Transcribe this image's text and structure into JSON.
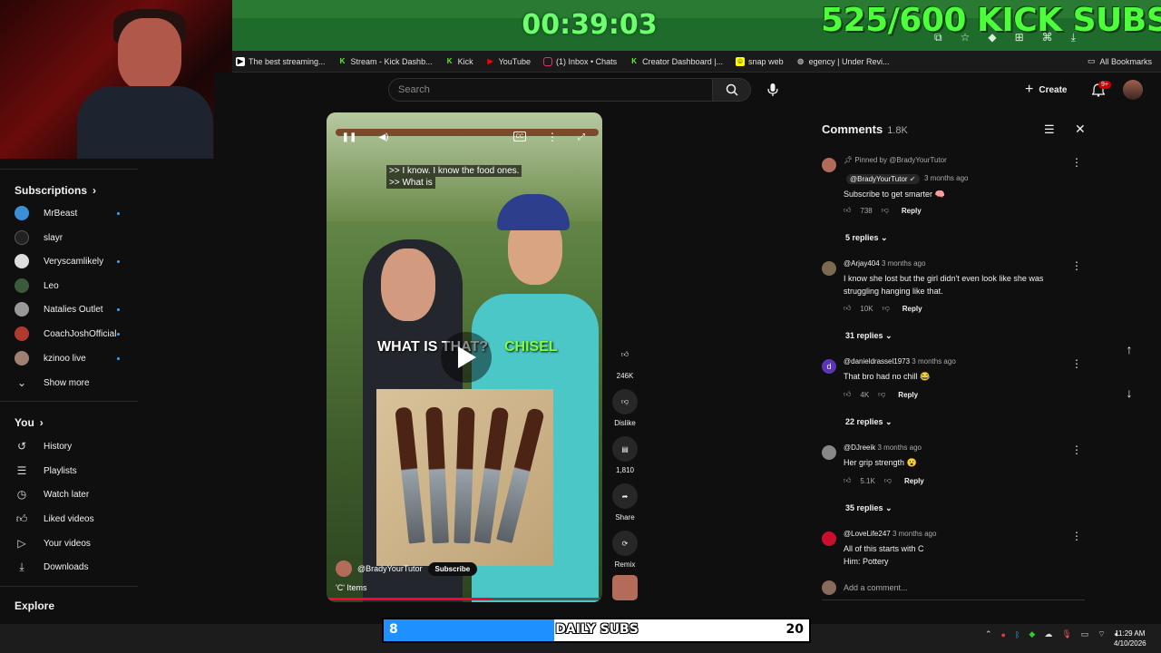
{
  "stream_overlay": {
    "timer": "00:39:03",
    "sub_goal": "525/600 KICK SUBS",
    "daily_subs": {
      "label": "DAILY SUBS",
      "current": "8",
      "target": "20",
      "progress": 0.4
    }
  },
  "bookmarks": {
    "items": [
      {
        "label": "The best streaming...",
        "icon": "clapper-icon",
        "color": "#ffffff"
      },
      {
        "label": "Stream - Kick Dashb...",
        "icon": "kick-icon",
        "color": "#53fc18"
      },
      {
        "label": "Kick",
        "icon": "kick-icon",
        "color": "#53fc18"
      },
      {
        "label": "YouTube",
        "icon": "youtube-icon",
        "color": "#ff0000"
      },
      {
        "label": "(1) Inbox • Chats",
        "icon": "instagram-icon",
        "color": "#e1306c"
      },
      {
        "label": "Creator Dashboard |...",
        "icon": "kick-icon",
        "color": "#53fc18"
      },
      {
        "label": "snap web",
        "icon": "snapchat-icon",
        "color": "#fffc00"
      },
      {
        "label": "egency | Under Revi...",
        "icon": "globe-icon",
        "color": "#888888"
      }
    ],
    "all_bookmarks": "All Bookmarks"
  },
  "header": {
    "search_placeholder": "Search",
    "create_label": "Create",
    "notification_badge": "9+"
  },
  "sidebar": {
    "subscriptions_title": "Subscriptions",
    "subscriptions": [
      {
        "label": "MrBeast",
        "new": true,
        "color": "#3a8fd6"
      },
      {
        "label": "slayr",
        "new": false,
        "color": "#222222"
      },
      {
        "label": "Veryscamlikely",
        "new": true,
        "color": "#dddddd"
      },
      {
        "label": "Leo",
        "new": false,
        "color": "#3a5a3a"
      },
      {
        "label": "Natalies Outlet",
        "new": true,
        "color": "#999999"
      },
      {
        "label": "CoachJoshOfficial",
        "new": true,
        "color": "#b03a2e"
      },
      {
        "label": "kzinoo live",
        "new": true,
        "color": "#a08070"
      }
    ],
    "show_more": "Show more",
    "you_title": "You",
    "you_items": [
      {
        "label": "History",
        "icon": "history-icon"
      },
      {
        "label": "Playlists",
        "icon": "playlist-icon"
      },
      {
        "label": "Watch later",
        "icon": "clock-icon"
      },
      {
        "label": "Liked videos",
        "icon": "thumbs-up-icon"
      },
      {
        "label": "Your videos",
        "icon": "video-icon"
      },
      {
        "label": "Downloads",
        "icon": "download-icon"
      }
    ],
    "explore_title": "Explore"
  },
  "video": {
    "caption_line1": ">> I know. I know the food ones.",
    "caption_line2": ">> What is",
    "overlay_left": "WHAT IS THAT?",
    "overlay_right": "CHISEL",
    "channel": "@BradyYourTutor",
    "subscribe": "Subscribe",
    "title": "'C' Items",
    "progress": 0.6
  },
  "actions": {
    "likes": "246K",
    "dislike": "Dislike",
    "comments": "1,810",
    "share": "Share",
    "remix": "Remix"
  },
  "comments": {
    "title": "Comments",
    "count": "1.8K",
    "add_placeholder": "Add a comment...",
    "items": [
      {
        "pinned": "Pinned by @BradyYourTutor",
        "author": "@BradyYourTutor",
        "time": "3 months ago",
        "text": "Subscribe to get smarter 🧠",
        "likes": "738",
        "replies": "5 replies",
        "reply": "Reply",
        "color": "#b36b5a"
      },
      {
        "author": "@Arjay404",
        "time": "3 months ago",
        "text": "I know she lost but the girl didn't even look like she was struggling hanging like that.",
        "likes": "10K",
        "replies": "31 replies",
        "reply": "Reply",
        "color": "#7a6a50"
      },
      {
        "author": "@danieldrassel1973",
        "time": "3 months ago",
        "text": "That bro had no chill 😂",
        "likes": "4K",
        "replies": "22 replies",
        "reply": "Reply",
        "color": "#5c35b5",
        "initial": "d"
      },
      {
        "author": "@DJreeik",
        "time": "3 months ago",
        "text": "Her grip strength 😮",
        "likes": "5.1K",
        "replies": "35 replies",
        "reply": "Reply",
        "color": "#888888"
      },
      {
        "author": "@LoveLife247",
        "time": "3 months ago",
        "text": "All of this starts with C",
        "text2": "Him: Pottery",
        "color": "#c8102e"
      }
    ]
  },
  "taskbar": {
    "time": "11:29 AM",
    "date": "4/10/2026"
  }
}
